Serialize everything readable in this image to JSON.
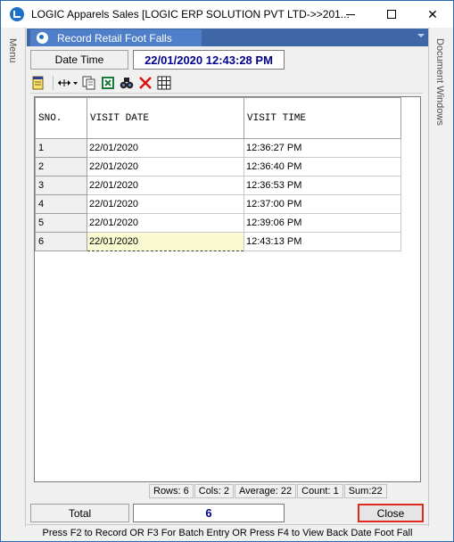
{
  "window": {
    "title": "LOGIC Apparels Sales  [LOGIC ERP SOLUTION PVT LTD->>201...",
    "controls": {
      "minimize": "–",
      "maximize": "□",
      "close": "✕"
    }
  },
  "side_panels": {
    "left": "Menu",
    "right": "Document Windows"
  },
  "tab": {
    "label": "Record Retail Foot Falls"
  },
  "date_time": {
    "label": "Date Time",
    "value": "22/01/2020   12:43:28 PM"
  },
  "toolbar": {
    "icons": [
      "notepad-icon",
      "column-width-icon",
      "copy-icon",
      "excel-icon",
      "binoculars-icon",
      "delete-icon",
      "grid-icon"
    ]
  },
  "grid": {
    "columns": [
      "SNO.",
      "VISIT DATE",
      "VISIT TIME"
    ],
    "rows": [
      {
        "sno": "1",
        "date": "22/01/2020",
        "time": "12:36:27 PM"
      },
      {
        "sno": "2",
        "date": "22/01/2020",
        "time": "12:36:40 PM"
      },
      {
        "sno": "3",
        "date": "22/01/2020",
        "time": "12:36:53 PM"
      },
      {
        "sno": "4",
        "date": "22/01/2020",
        "time": "12:37:00 PM"
      },
      {
        "sno": "5",
        "date": "22/01/2020",
        "time": "12:39:06 PM"
      },
      {
        "sno": "6",
        "date": "22/01/2020",
        "time": "12:43:13 PM"
      }
    ]
  },
  "status": {
    "rows": "Rows: 6",
    "cols": "Cols: 2",
    "average": "Average: 22",
    "count": "Count: 1",
    "sum": "Sum:22"
  },
  "total": {
    "label": "Total",
    "value": "6"
  },
  "close_label": "Close",
  "hint": "Press F2 to Record  OR F3 For Batch Entry OR Press F4 to View Back Date Foot Fall",
  "colors": {
    "tab_bar": "#3f66a7",
    "tab": "#4f7fc8",
    "value_text": "#00008b",
    "close_border": "#e0281e"
  }
}
